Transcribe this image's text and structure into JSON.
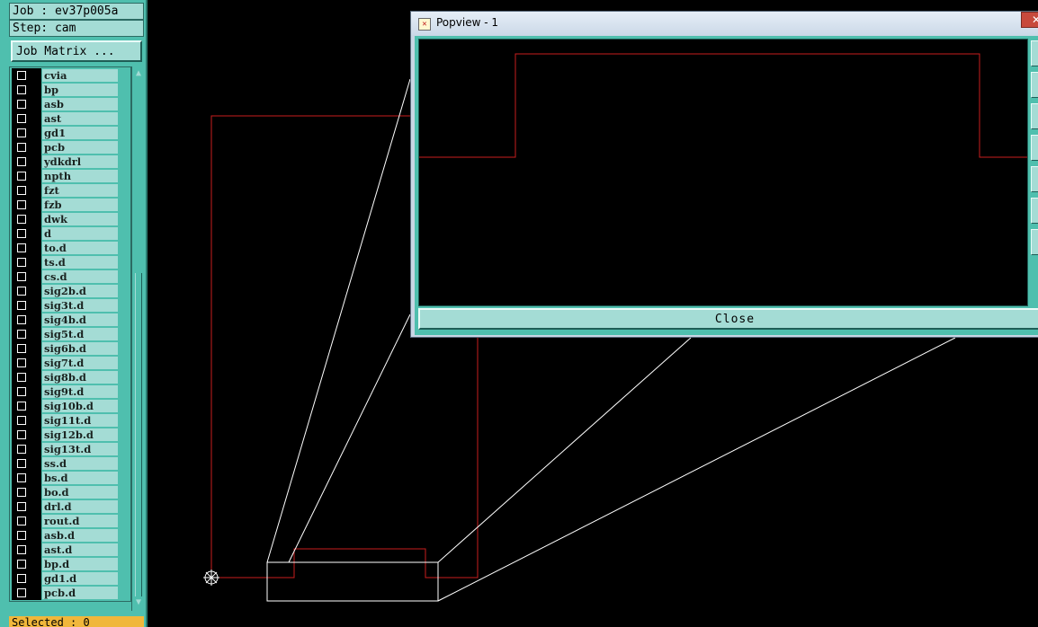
{
  "job_label": "Job : ev37p005a",
  "step_label": "Step: cam",
  "job_matrix_button": "Job Matrix ...",
  "layers": [
    "cvia",
    "bp",
    "asb",
    "ast",
    "gd1",
    "pcb",
    "ydkdrl",
    "npth",
    "fzt",
    "fzb",
    "dwk",
    "d",
    "to.d",
    "ts.d",
    "cs.d",
    "sig2b.d",
    "sig3t.d",
    "sig4b.d",
    "sig5t.d",
    "sig6b.d",
    "sig7t.d",
    "sig8b.d",
    "sig9t.d",
    "sig10b.d",
    "sig11t.d",
    "sig12b.d",
    "sig13t.d",
    "ss.d",
    "bs.d",
    "bo.d",
    "drl.d",
    "rout.d",
    "asb.d",
    "ast.d",
    "bp.d",
    "gd1.d",
    "pcb.d"
  ],
  "selected_label": "Selected : 0",
  "popview": {
    "title": "Popview - 1",
    "close_x": "✕",
    "close_button": "Close"
  },
  "colors": {
    "panel": "#4fbfae",
    "panel_light": "#a4dcd5",
    "profile_red": "#c81e1e",
    "zoom_white": "#ffffff",
    "selected_bar": "#f0b73b"
  },
  "icons": {
    "origin": "origin-crosshair-icon",
    "scroll_up": "scroll-up-arrow-icon",
    "scroll_down": "scroll-down-arrow-icon",
    "window_icon": "popview-window-icon"
  }
}
